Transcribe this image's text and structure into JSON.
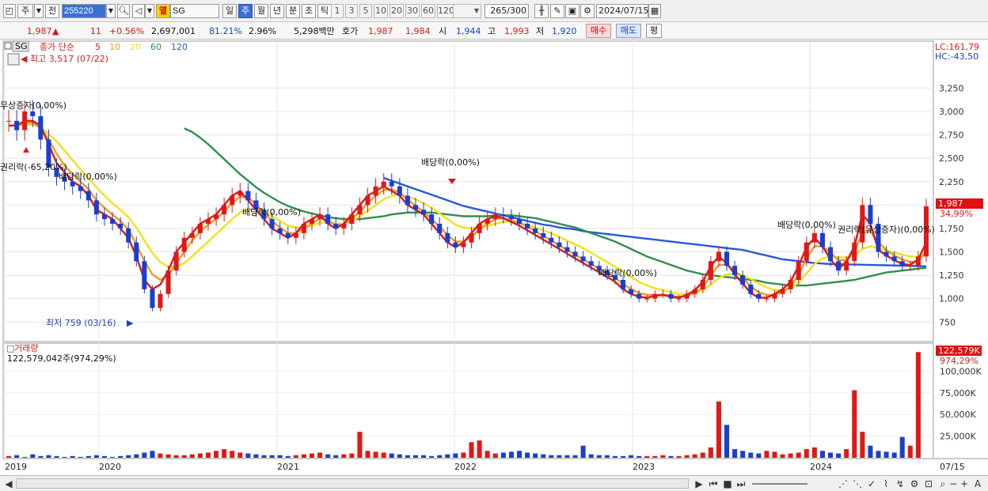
{
  "toolbar": {
    "type_label": "주",
    "prev_label": "전",
    "code_value": "255220",
    "name_value": "SG",
    "mode_label": "열",
    "periods": [
      "일",
      "주",
      "월",
      "년",
      "분",
      "초",
      "틱"
    ],
    "selected_period": "주",
    "intervals": [
      "1",
      "3",
      "5",
      "10",
      "20",
      "30",
      "60",
      "120"
    ],
    "count_value": "265",
    "count_total": "/300",
    "date_value": "2024/07/15"
  },
  "quote": {
    "price": "1,987",
    "change_arrow": "▲",
    "change": "11",
    "change_pct": "+0.56%",
    "volume": "2,697,001",
    "vol_ratio": "81.21%",
    "turnover": "2.96%",
    "amount": "5,298백만",
    "hoga_label": "호가",
    "ask": "1,987",
    "bid": "1,984",
    "open_label": "시",
    "open": "1,944",
    "high_label": "고",
    "high": "1,993",
    "low_label": "저",
    "low": "1,920",
    "buy_label": "매수",
    "sell_label": "매도",
    "eval_label": "평"
  },
  "chart_data": {
    "type": "candlestick",
    "title": "SG",
    "legend": {
      "label": "종가 단순",
      "periods": [
        "5",
        "10",
        "20",
        "60",
        "120"
      ],
      "colors": [
        "#d61c1c",
        "#f39a1e",
        "#f0e21a",
        "#2f8f4f",
        "#2b57d9"
      ]
    },
    "x_years": [
      "2019",
      "2020",
      "2021",
      "2022",
      "2023",
      "2024"
    ],
    "x_end_label": "07/15",
    "y_ticks": [
      "3,250",
      "3,000",
      "2,750",
      "2,500",
      "2,250",
      "2,000",
      "1,750",
      "1,500",
      "1,250",
      "1,000",
      "750"
    ],
    "ylim": [
      600,
      3600
    ],
    "lc_label": "LC:161,79",
    "hc_label": "HC:-43,50",
    "last_price_label": "1,987",
    "last_pct_label": "34,99%",
    "annotations": {
      "max_label": "최고 3,517 (07/22)",
      "min_label": "최저 759 (03/16)",
      "events": [
        "무상증자(0,00%)",
        "권리락(-65,20%)",
        "배당락(0,00%)",
        "배당락(0,00%)",
        "배당락(0,00%)",
        "배당락(0,00%)",
        "배당락(0,00%)",
        "권리락(유상증자)(0,00%)"
      ]
    },
    "volume_panel": {
      "title": "거래량",
      "info": "122,579,042주(974,29%)",
      "last_label": "122,579K",
      "last_pct": "974,29%",
      "y_ticks": [
        "100,000K",
        "75,000K",
        "50,000K",
        "25,000K"
      ],
      "ylim": [
        0,
        125
      ]
    },
    "series": [
      {
        "name": "price_close_weekly",
        "values": [
          2900,
          2800,
          3000,
          2950,
          2700,
          2400,
          2300,
          2250,
          2200,
          2150,
          2050,
          1900,
          1850,
          1800,
          1750,
          1600,
          1400,
          1100,
          900,
          1050,
          1300,
          1500,
          1650,
          1700,
          1800,
          1850,
          1900,
          2000,
          2100,
          2150,
          2050,
          1950,
          1850,
          1750,
          1700,
          1650,
          1700,
          1800,
          1850,
          1900,
          1800,
          1750,
          1800,
          1900,
          2000,
          2100,
          2200,
          2250,
          2200,
          2100,
          2000,
          1950,
          1900,
          1800,
          1700,
          1600,
          1550,
          1600,
          1700,
          1800,
          1850,
          1900,
          1880,
          1850,
          1800,
          1750,
          1700,
          1650,
          1600,
          1550,
          1500,
          1450,
          1400,
          1350,
          1300,
          1250,
          1200,
          1100,
          1050,
          1000,
          1000,
          1050,
          1050,
          1000,
          1000,
          1050,
          1100,
          1200,
          1400,
          1500,
          1350,
          1250,
          1150,
          1050,
          1000,
          1000,
          1050,
          1100,
          1200,
          1400,
          1600,
          1700,
          1550,
          1400,
          1300,
          1400,
          1600,
          2000,
          1800,
          1500,
          1450,
          1400,
          1350,
          1350,
          1450,
          1987
        ]
      },
      {
        "name": "ma5",
        "values": [
          2850,
          2850,
          2900,
          2900,
          2850,
          2650,
          2450,
          2350,
          2250,
          2200,
          2100,
          1950,
          1900,
          1850,
          1750,
          1650,
          1450,
          1200,
          1100,
          1150,
          1300,
          1500,
          1600,
          1700,
          1800,
          1850,
          1900,
          2000,
          2100,
          2150,
          2050,
          1950,
          1850,
          1750,
          1700,
          1650,
          1700,
          1800,
          1850,
          1900,
          1800,
          1750,
          1800,
          1900,
          2000,
          2100,
          2150,
          2200,
          2150,
          2100,
          2000,
          1950,
          1900,
          1800,
          1700,
          1600,
          1550,
          1600,
          1700,
          1800,
          1850,
          1880,
          1860,
          1820,
          1780,
          1730,
          1680,
          1630,
          1580,
          1530,
          1480,
          1430,
          1380,
          1330,
          1280,
          1230,
          1180,
          1100,
          1050,
          1020,
          1010,
          1030,
          1040,
          1020,
          1010,
          1040,
          1090,
          1180,
          1350,
          1450,
          1380,
          1260,
          1160,
          1060,
          1010,
          1010,
          1050,
          1100,
          1180,
          1350,
          1550,
          1650,
          1560,
          1420,
          1320,
          1390,
          1560,
          1900,
          1800,
          1520,
          1460,
          1410,
          1370,
          1360,
          1420,
          1600
        ]
      },
      {
        "name": "ma10",
        "values": [
          2850,
          2850,
          2880,
          2880,
          2820,
          2700,
          2550,
          2420,
          2330,
          2250,
          2170,
          2050,
          1970,
          1900,
          1830,
          1740,
          1580,
          1400,
          1260,
          1200,
          1250,
          1380,
          1500,
          1620,
          1720,
          1790,
          1850,
          1930,
          2020,
          2090,
          2080,
          2010,
          1920,
          1830,
          1760,
          1700,
          1700,
          1750,
          1800,
          1860,
          1830,
          1790,
          1790,
          1850,
          1930,
          2020,
          2100,
          2160,
          2170,
          2130,
          2060,
          1990,
          1930,
          1850,
          1770,
          1680,
          1610,
          1610,
          1660,
          1740,
          1800,
          1850,
          1860,
          1840,
          1810,
          1770,
          1720,
          1670,
          1620,
          1570,
          1520,
          1470,
          1420,
          1370,
          1320,
          1270,
          1220,
          1160,
          1100,
          1060,
          1040,
          1040,
          1040,
          1030,
          1020,
          1030,
          1060,
          1120,
          1250,
          1360,
          1360,
          1300,
          1220,
          1130,
          1070,
          1040,
          1040,
          1070,
          1130,
          1250,
          1430,
          1560,
          1560,
          1490,
          1410,
          1410,
          1500,
          1700,
          1720,
          1600,
          1520,
          1460,
          1420,
          1390,
          1400,
          1500
        ]
      },
      {
        "name": "ma20",
        "values": [
          2850,
          2850,
          2860,
          2860,
          2830,
          2760,
          2680,
          2580,
          2480,
          2380,
          2290,
          2190,
          2100,
          2020,
          1950,
          1870,
          1760,
          1620,
          1490,
          1390,
          1340,
          1340,
          1380,
          1450,
          1530,
          1610,
          1690,
          1770,
          1850,
          1920,
          1950,
          1960,
          1930,
          1880,
          1830,
          1780,
          1760,
          1760,
          1780,
          1810,
          1810,
          1800,
          1800,
          1830,
          1880,
          1940,
          2000,
          2060,
          2100,
          2110,
          2090,
          2060,
          2020,
          1970,
          1910,
          1850,
          1790,
          1760,
          1750,
          1760,
          1780,
          1800,
          1820,
          1820,
          1810,
          1790,
          1760,
          1730,
          1700,
          1660,
          1620,
          1580,
          1540,
          1490,
          1440,
          1390,
          1340,
          1290,
          1230,
          1180,
          1140,
          1110,
          1090,
          1070,
          1050,
          1050,
          1060,
          1090,
          1150,
          1220,
          1260,
          1270,
          1250,
          1210,
          1160,
          1120,
          1090,
          1090,
          1110,
          1170,
          1270,
          1370,
          1430,
          1450,
          1440,
          1440,
          1460,
          1530,
          1560,
          1540,
          1510,
          1490,
          1470,
          1450,
          1450,
          1480
        ]
      },
      {
        "name": "ma60",
        "values": [
          null,
          null,
          null,
          null,
          null,
          null,
          null,
          null,
          null,
          null,
          null,
          null,
          null,
          null,
          null,
          null,
          null,
          null,
          null,
          null,
          null,
          null,
          2820,
          2780,
          2720,
          2650,
          2570,
          2490,
          2410,
          2330,
          2260,
          2190,
          2130,
          2080,
          2030,
          1990,
          1960,
          1930,
          1910,
          1890,
          1870,
          1860,
          1850,
          1850,
          1850,
          1860,
          1870,
          1880,
          1900,
          1910,
          1920,
          1920,
          1920,
          1920,
          1910,
          1900,
          1890,
          1880,
          1880,
          1880,
          1880,
          1890,
          1890,
          1890,
          1880,
          1870,
          1860,
          1840,
          1820,
          1800,
          1780,
          1760,
          1730,
          1700,
          1670,
          1640,
          1610,
          1570,
          1530,
          1490,
          1450,
          1420,
          1390,
          1360,
          1330,
          1300,
          1280,
          1260,
          1250,
          1240,
          1230,
          1220,
          1210,
          1200,
          1190,
          1170,
          1160,
          1150,
          1140,
          1140,
          1140,
          1150,
          1160,
          1170,
          1180,
          1190,
          1200,
          1220,
          1240,
          1260,
          1280,
          1290,
          1300,
          1310,
          1320,
          1330
        ]
      },
      {
        "name": "ma120",
        "values": [
          null,
          null,
          null,
          null,
          null,
          null,
          null,
          null,
          null,
          null,
          null,
          null,
          null,
          null,
          null,
          null,
          null,
          null,
          null,
          null,
          null,
          null,
          null,
          null,
          null,
          null,
          null,
          null,
          null,
          null,
          null,
          null,
          null,
          null,
          null,
          null,
          null,
          null,
          null,
          null,
          null,
          null,
          null,
          null,
          null,
          null,
          null,
          2290,
          2260,
          2230,
          2200,
          2170,
          2140,
          2110,
          2080,
          2050,
          2020,
          1990,
          1970,
          1950,
          1930,
          1910,
          1890,
          1870,
          1850,
          1830,
          1810,
          1790,
          1780,
          1760,
          1750,
          1740,
          1720,
          1710,
          1700,
          1690,
          1680,
          1670,
          1660,
          1650,
          1640,
          1630,
          1620,
          1610,
          1600,
          1590,
          1580,
          1570,
          1560,
          1550,
          1540,
          1530,
          1520,
          1500,
          1480,
          1460,
          1440,
          1420,
          1410,
          1400,
          1390,
          1380,
          1375,
          1370,
          1368,
          1366,
          1364,
          1362,
          1360,
          1358,
          1356,
          1354,
          1352,
          1350,
          1348,
          1345
        ]
      },
      {
        "name": "volume_k",
        "values": [
          2,
          3,
          1,
          4,
          2,
          3,
          2,
          1,
          2,
          1,
          2,
          3,
          2,
          1,
          2,
          3,
          4,
          6,
          8,
          5,
          4,
          3,
          3,
          4,
          5,
          6,
          8,
          10,
          8,
          6,
          5,
          4,
          3,
          3,
          3,
          2,
          3,
          4,
          5,
          6,
          4,
          3,
          4,
          5,
          30,
          8,
          7,
          6,
          5,
          4,
          3,
          3,
          3,
          2,
          3,
          4,
          5,
          6,
          18,
          20,
          8,
          5,
          6,
          7,
          8,
          6,
          5,
          4,
          3,
          3,
          3,
          3,
          14,
          4,
          3,
          3,
          2,
          2,
          3,
          2,
          2,
          2,
          3,
          2,
          2,
          3,
          4,
          6,
          12,
          65,
          38,
          10,
          8,
          6,
          5,
          8,
          7,
          4,
          5,
          6,
          10,
          12,
          8,
          6,
          5,
          10,
          78,
          30,
          14,
          8,
          7,
          6,
          24,
          14,
          122
        ]
      }
    ]
  }
}
